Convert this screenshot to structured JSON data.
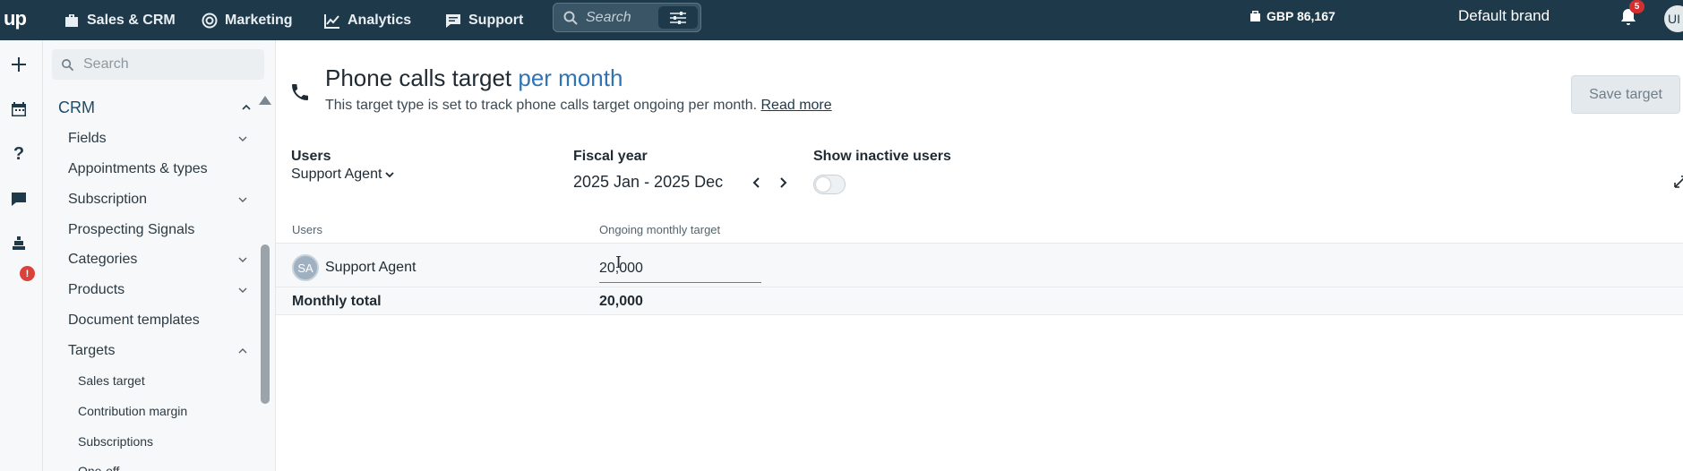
{
  "topbar": {
    "logo": "up",
    "nav": [
      {
        "label": "Sales & CRM",
        "icon": "briefcase-icon"
      },
      {
        "label": "Marketing",
        "icon": "target-icon"
      },
      {
        "label": "Analytics",
        "icon": "line-chart-icon"
      },
      {
        "label": "Support",
        "icon": "chat-icon"
      }
    ],
    "search_label": "Search",
    "balance": "GBP 86,167",
    "brand": "Default brand",
    "notifications_count": "5",
    "user_initials": "UI"
  },
  "rail": {
    "badge": "!"
  },
  "sidebar": {
    "search_placeholder": "Search",
    "section": "CRM",
    "items": [
      {
        "label": "Fields",
        "expandable": true
      },
      {
        "label": "Appointments & types",
        "expandable": false
      },
      {
        "label": "Subscription",
        "expandable": true
      },
      {
        "label": "Prospecting Signals",
        "expandable": false
      },
      {
        "label": "Categories",
        "expandable": true
      },
      {
        "label": "Products",
        "expandable": true
      },
      {
        "label": "Document templates",
        "expandable": false
      },
      {
        "label": "Targets",
        "expandable": true,
        "expanded": true
      }
    ],
    "sub_items": [
      "Sales target",
      "Contribution margin",
      "Subscriptions",
      "One-off"
    ]
  },
  "main": {
    "title_main": "Phone calls target",
    "title_accent": "per month",
    "description": "This target type is set to track phone calls target ongoing per month.",
    "read_more": "Read more",
    "save_button": "Save target",
    "filters": {
      "users_label": "Users",
      "users_value": "Support Agent",
      "fiscal_label": "Fiscal year",
      "fiscal_value": "2025 Jan - 2025 Dec",
      "inactive_label": "Show inactive users",
      "inactive_on": false
    },
    "table": {
      "headers": [
        "Users",
        "Ongoing monthly target"
      ],
      "rows": [
        {
          "initials": "SA",
          "name": "Support Agent",
          "target": "20,000"
        }
      ],
      "total_label": "Monthly total",
      "total_value": "20,000"
    }
  },
  "colors": {
    "topbar": "#1e3a4a",
    "accent": "#2f74b5",
    "badge_red": "#d32f2f"
  }
}
